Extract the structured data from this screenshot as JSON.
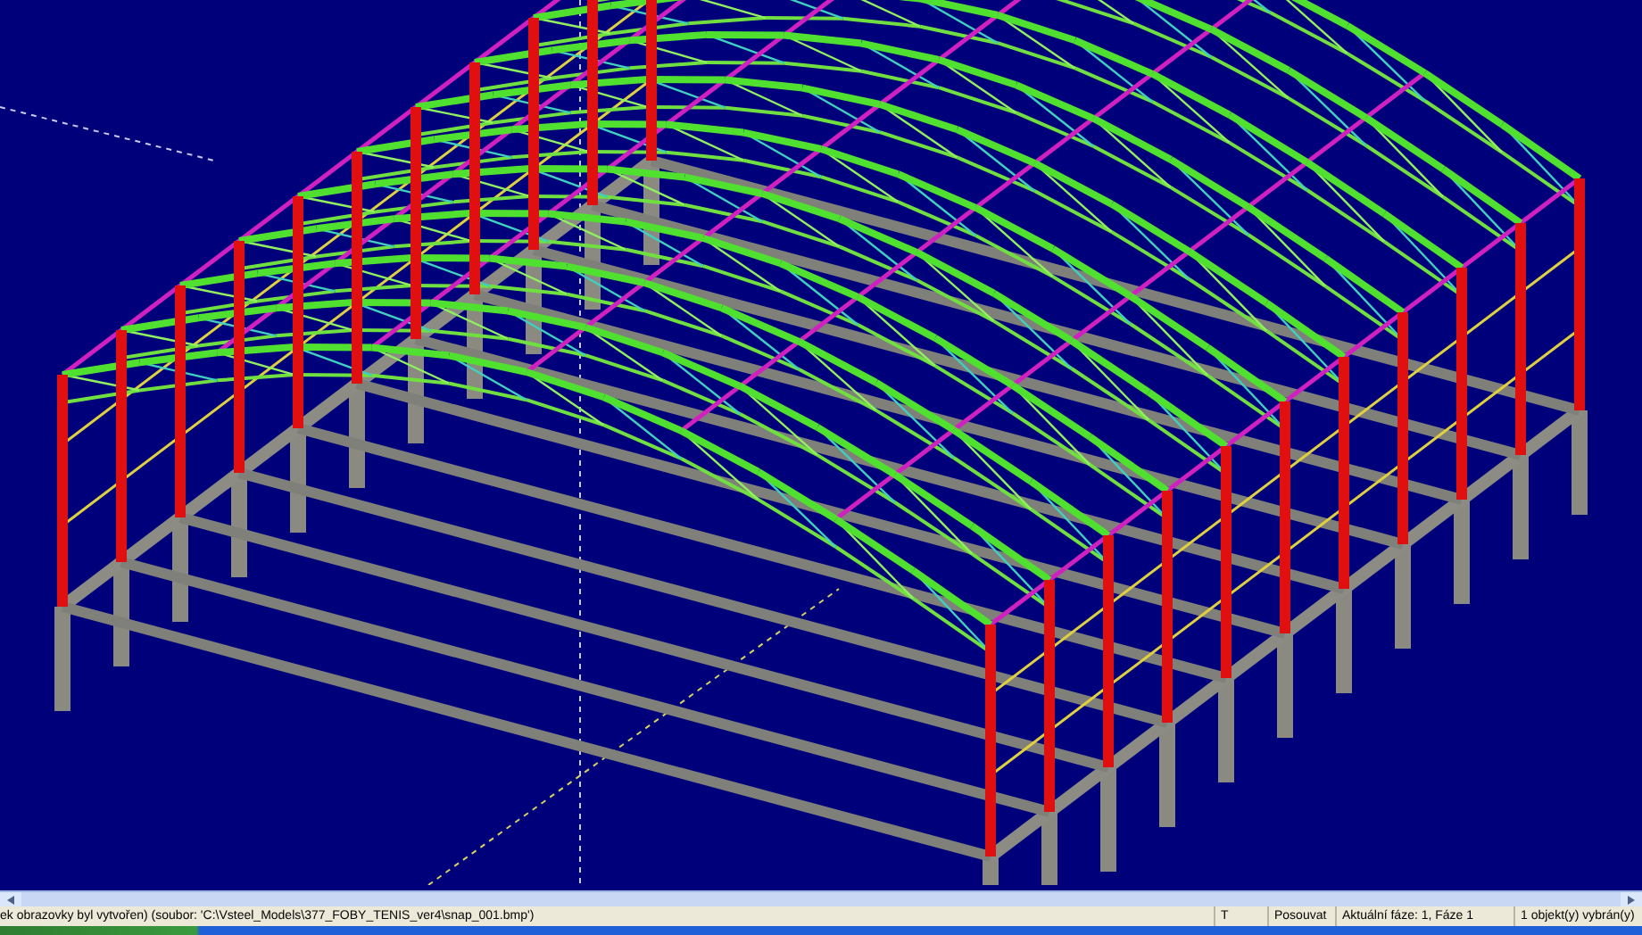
{
  "status_bar": {
    "message": "ek obrazovky byl vytvořen) (soubor: 'C:\\Vsteel_Models\\377_FOBY_TENIS_ver4\\snap_001.bmp')",
    "mode": "T",
    "action": "Posouvat",
    "phase": "Aktuální fáze: 1, Fáze 1",
    "selection": "1 objekt(y) vybrán(y)"
  }
}
